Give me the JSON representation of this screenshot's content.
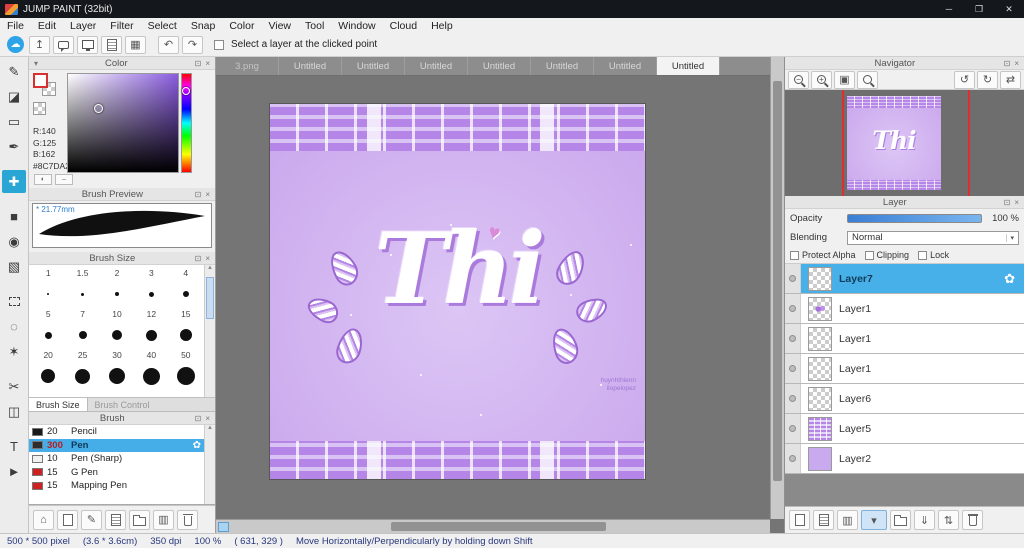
{
  "titlebar": {
    "title": "JUMP PAINT (32bit)"
  },
  "menu": {
    "items": [
      "File",
      "Edit",
      "Layer",
      "Filter",
      "Select",
      "Snap",
      "Color",
      "View",
      "Tool",
      "Window",
      "Cloud",
      "Help"
    ]
  },
  "toolbar": {
    "select_layer_checkbox": "Select a layer at the clicked point"
  },
  "color_panel": {
    "title": "Color",
    "r": "R:140",
    "g": "G:125",
    "b": "B:162",
    "hex": "#8C7DA2"
  },
  "brush_preview_panel": {
    "title": "Brush Preview",
    "size_label": "* 21.77mm"
  },
  "brush_size_panel": {
    "title": "Brush Size",
    "labels": [
      "1",
      "1.5",
      "2",
      "3",
      "4",
      "5",
      "7",
      "10",
      "12",
      "15",
      "20",
      "25",
      "30",
      "40",
      "50"
    ],
    "tab_active": "Brush Size",
    "tab_inactive": "Brush Control"
  },
  "brush_panel": {
    "title": "Brush",
    "items": [
      {
        "size": "20",
        "name": "Pencil"
      },
      {
        "size": "300",
        "name": "Pen"
      },
      {
        "size": "10",
        "name": "Pen (Sharp)"
      },
      {
        "size": "15",
        "name": "G Pen"
      },
      {
        "size": "15",
        "name": "Mapping Pen"
      }
    ]
  },
  "document_tabs": {
    "tabs": [
      "3.png",
      "Untitled",
      "Untitled",
      "Untitled",
      "Untitled",
      "Untitled",
      "Untitled",
      "Untitled"
    ]
  },
  "navigator_panel": {
    "title": "Navigator"
  },
  "layer_panel": {
    "title": "Layer",
    "opacity_label": "Opacity",
    "opacity_value": "100 %",
    "blending_label": "Blending",
    "blending_value": "Normal",
    "protect_alpha_label": "Protect Alpha",
    "clipping_label": "Clipping",
    "lock_label": "Lock",
    "layers": [
      {
        "name": "Layer7"
      },
      {
        "name": "Layer1"
      },
      {
        "name": "Layer1"
      },
      {
        "name": "Layer1"
      },
      {
        "name": "Layer6"
      },
      {
        "name": "Layer5"
      },
      {
        "name": "Layer2"
      }
    ]
  },
  "statusbar": {
    "size": "500 * 500 pixel",
    "cm": "(3.6 * 3.6cm)",
    "dpi": "350 dpi",
    "zoom": "100 %",
    "coords": "( 631, 329 )",
    "hint": "Move Horizontally/Perpendicularly by holding down Shift"
  },
  "artwork": {
    "word": "Thi",
    "watermark_line1": "huynhthienn",
    "watermark_line2": "ilopelopez"
  },
  "colors": {
    "accent_blue": "#45aee8",
    "canvas_gray": "#757575",
    "lilac": "#c9a5ec",
    "plaid_purple": "#b586e7"
  }
}
